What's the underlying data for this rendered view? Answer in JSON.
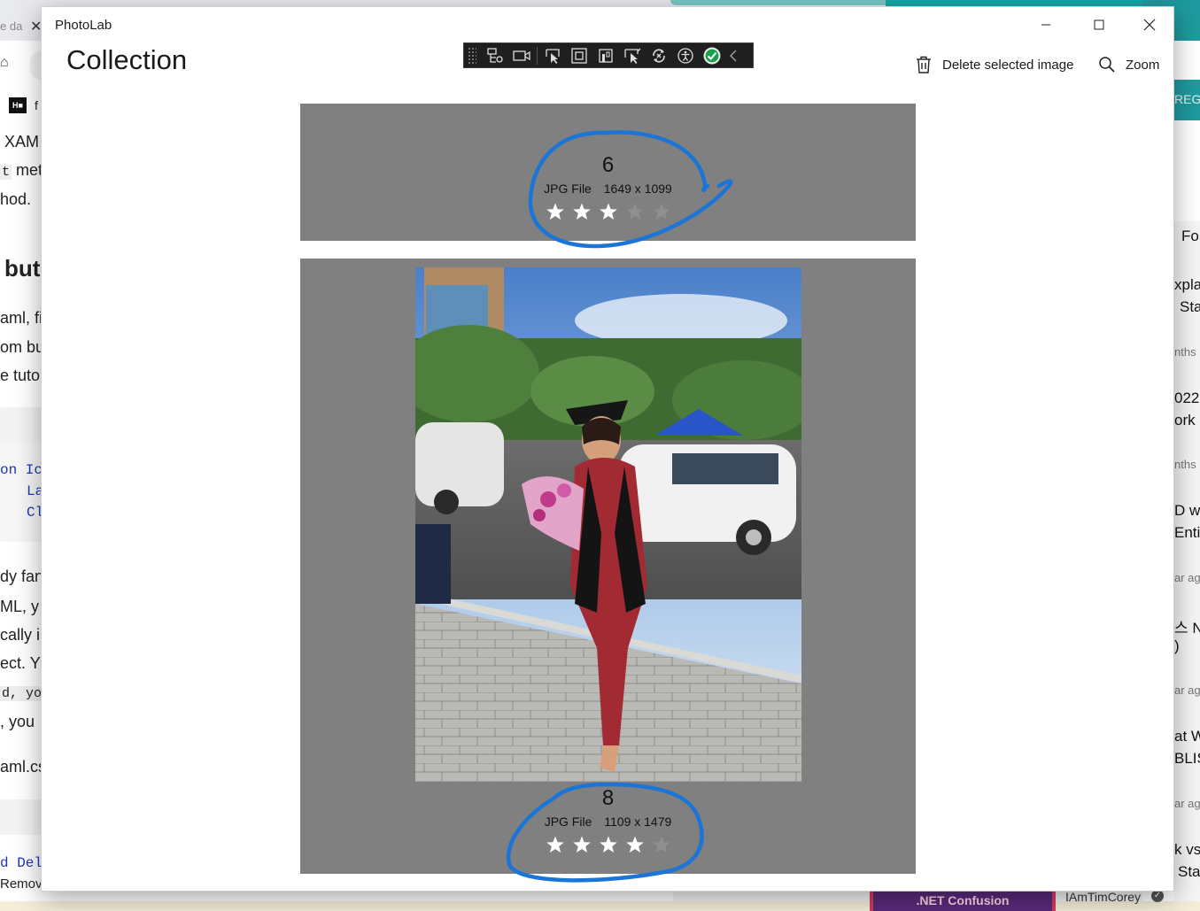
{
  "background_left": {
    "tab_text": "e da",
    "bookmark_text": "f",
    "lines": [
      "XAM",
      "met",
      "hod.",
      "but",
      "aml, fi",
      "om bu",
      "e tuto",
      "on Ic",
      "La",
      "Cl",
      "dy fan",
      "ML, y",
      "cally i",
      "ect. Y",
      "d, yo",
      ", you",
      "aml.cs",
      "d Del",
      "Remov"
    ]
  },
  "background_right": {
    "banner": "REGIS",
    "lines": [
      "For",
      "xpla",
      "Sta",
      "nths",
      "022",
      "ork",
      "nths",
      "D w",
      "Entit",
      "ar ag",
      "스 N",
      ")",
      "ar ag",
      "at W",
      "BLIS",
      "ar ag",
      "k vs",
      "Sta"
    ],
    "promo": ".NET Confusion",
    "author": "IAmTimCorey"
  },
  "window": {
    "title": "PhotoLab",
    "page_title": "Collection",
    "commands": {
      "delete_label": "Delete selected image",
      "zoom_label": "Zoom"
    }
  },
  "debug_toolbar": {
    "icons": [
      "live-visual-tree-icon",
      "record-icon",
      "select-element-icon",
      "display-layout-adorners-icon",
      "track-focus-icon",
      "binding-failures-icon",
      "hot-reload-icon",
      "accessibility-icon",
      "checkmark-icon",
      "collapse-icon"
    ]
  },
  "gallery": {
    "items": [
      {
        "number": "6",
        "file_type": "JPG File",
        "dimensions": "1649 x 1099",
        "rating": 3,
        "max_rating": 5
      },
      {
        "number": "8",
        "file_type": "JPG File",
        "dimensions": "1109 x 1479",
        "rating": 4,
        "max_rating": 5
      }
    ]
  },
  "colors": {
    "item_background": "#808080",
    "annotation_stroke": "#1a75d6",
    "star_on": "#ffffff",
    "star_off": "#8f8f8f"
  }
}
